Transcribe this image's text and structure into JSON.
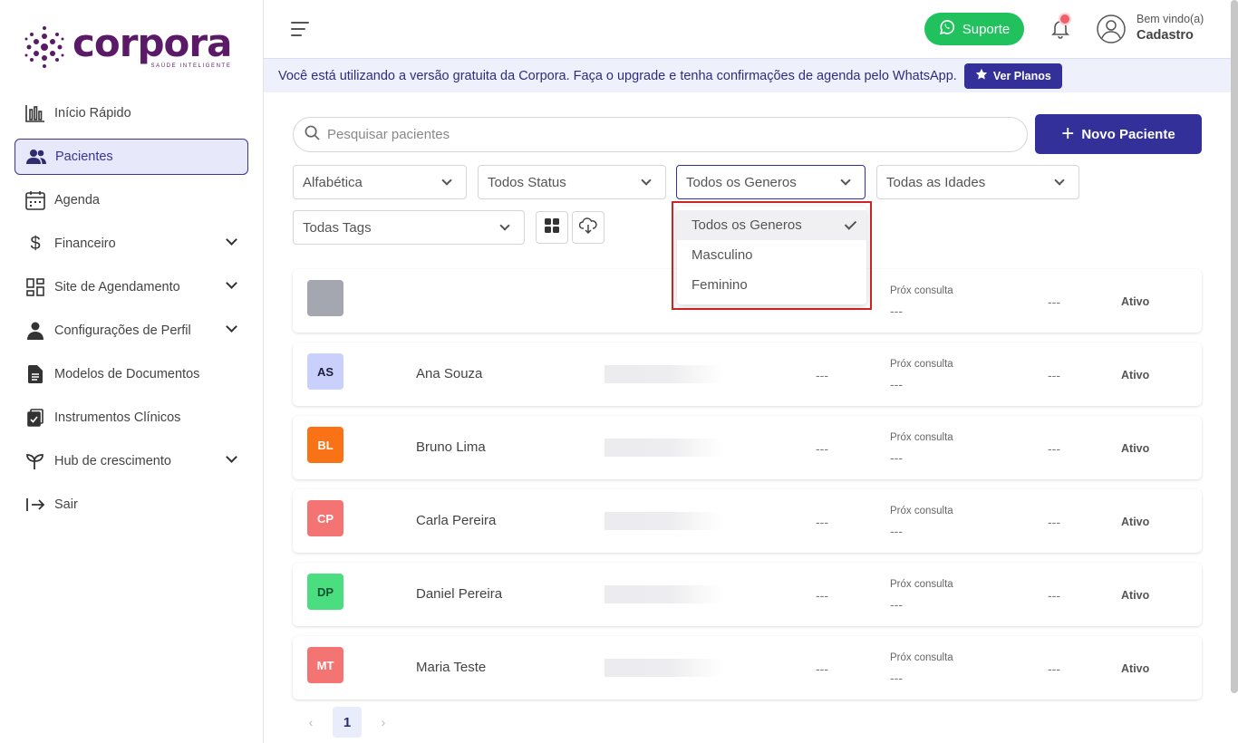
{
  "app": {
    "logo_text": "corpora",
    "logo_tagline": "SAÚDE INTELIGENTE"
  },
  "sidebar": {
    "items": [
      {
        "label": "Início Rápido",
        "icon": "bar-chart-icon",
        "expandable": false
      },
      {
        "label": "Pacientes",
        "icon": "users-icon",
        "expandable": false,
        "active": true
      },
      {
        "label": "Agenda",
        "icon": "calendar-icon",
        "expandable": false
      },
      {
        "label": "Financeiro",
        "icon": "dollar-icon",
        "expandable": true
      },
      {
        "label": "Site de Agendamento",
        "icon": "layout-grid-icon",
        "expandable": true
      },
      {
        "label": "Configurações de Perfil",
        "icon": "person-icon",
        "expandable": true
      },
      {
        "label": "Modelos de Documentos",
        "icon": "document-icon",
        "expandable": false
      },
      {
        "label": "Instrumentos Clínicos",
        "icon": "clipboard-check-icon",
        "expandable": false
      },
      {
        "label": "Hub de crescimento",
        "icon": "sprout-icon",
        "expandable": true
      },
      {
        "label": "Sair",
        "icon": "logout-icon",
        "expandable": false
      }
    ]
  },
  "header": {
    "support_label": "Suporte",
    "welcome_small": "Bem vindo(a)",
    "welcome_name": "Cadastro"
  },
  "banner": {
    "text": "Você está utilizando a versão gratuita da Corpora. Faça o upgrade e tenha confirmações de agenda pelo WhatsApp.",
    "button_label": "Ver Planos"
  },
  "toolbar": {
    "search_placeholder": "Pesquisar pacientes",
    "new_button_label": "Novo Paciente"
  },
  "filters": {
    "sort": "Alfabética",
    "status": "Todos Status",
    "gender": "Todos os Generos",
    "age": "Todas as Idades",
    "tags": "Todas Tags"
  },
  "gender_dropdown": {
    "options": [
      "Todos os Generos",
      "Masculino",
      "Feminino"
    ],
    "selected_index": 0
  },
  "patients": [
    {
      "initials": "",
      "name": "",
      "dash": "",
      "prox_label": "Próx consulta",
      "prox_value": "---",
      "dash2": "---",
      "status": "Ativo",
      "bg": "#a4a7b0",
      "fg": "#ffffff"
    },
    {
      "initials": "AS",
      "name": "Ana Souza",
      "dash": "---",
      "prox_label": "Próx consulta",
      "prox_value": "---",
      "dash2": "---",
      "status": "Ativo",
      "bg": "#c9d0fb",
      "fg": "#1d1d3a"
    },
    {
      "initials": "BL",
      "name": "Bruno Lima",
      "dash": "---",
      "prox_label": "Próx consulta",
      "prox_value": "---",
      "dash2": "---",
      "status": "Ativo",
      "bg": "#f97316",
      "fg": "#ffffff"
    },
    {
      "initials": "CP",
      "name": "Carla Pereira",
      "dash": "---",
      "prox_label": "Próx consulta",
      "prox_value": "---",
      "dash2": "---",
      "status": "Ativo",
      "bg": "#f47474",
      "fg": "#ffffff"
    },
    {
      "initials": "DP",
      "name": "Daniel Pereira",
      "dash": "---",
      "prox_label": "Próx consulta",
      "prox_value": "---",
      "dash2": "---",
      "status": "Ativo",
      "bg": "#4ade80",
      "fg": "#14532d"
    },
    {
      "initials": "MT",
      "name": "Maria Teste",
      "dash": "---",
      "prox_label": "Próx consulta",
      "prox_value": "---",
      "dash2": "---",
      "status": "Ativo",
      "bg": "#f47474",
      "fg": "#ffffff"
    }
  ],
  "pagination": {
    "current_page": "1",
    "prev_symbol": "‹",
    "next_symbol": "›"
  },
  "colors": {
    "brand": "#33309a",
    "logo": "#5b1a68",
    "support": "#21c25e",
    "highlight": "#d02424"
  }
}
